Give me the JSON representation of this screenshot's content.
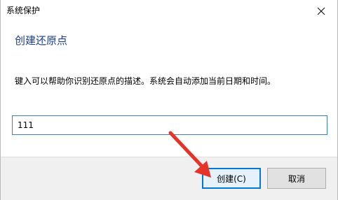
{
  "window": {
    "title": "系统保护"
  },
  "dialog": {
    "heading": "创建还原点",
    "description": "键入可以帮助你识别还原点的描述。系统会自动添加当前日期和时间。",
    "input_value": "111"
  },
  "buttons": {
    "create_label": "创建(C)",
    "cancel_label": "取消"
  },
  "colors": {
    "heading": "#1c3d8c",
    "accent": "#0078d7",
    "annotation_arrow": "#e5332a"
  },
  "icons": {
    "close": "close-icon",
    "annotation": "red-arrow-pointer"
  }
}
